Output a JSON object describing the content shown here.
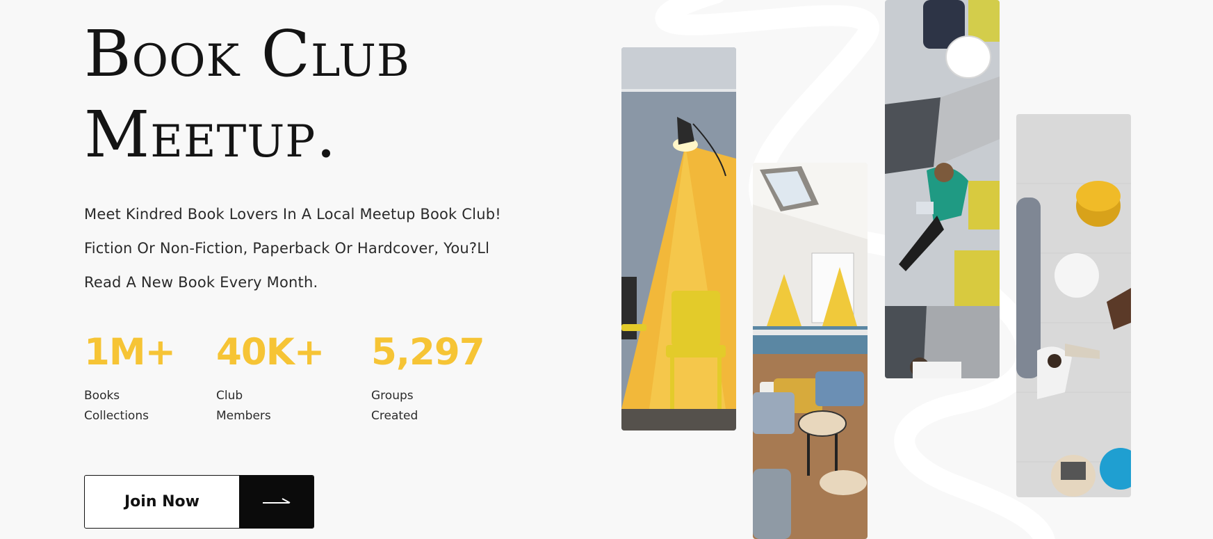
{
  "hero": {
    "title_line1": "Book Club",
    "title_line2": "Meetup.",
    "intro_lines": [
      "Meet Kindred Book Lovers In A Local Meetup Book Club!",
      "Fiction Or Non-Fiction, Paperback Or Hardcover, You?Ll",
      "Read A New Book Every Month."
    ]
  },
  "stats": [
    {
      "value": "1M+",
      "label_line1": "Books",
      "label_line2": "Collections"
    },
    {
      "value": "40K+",
      "label_line1": "Club",
      "label_line2": "Members"
    },
    {
      "value": "5,297",
      "label_line1": "Groups",
      "label_line2": "Created"
    }
  ],
  "cta": {
    "join_label": "Join Now",
    "arrow_icon": "long-arrow-right-icon"
  },
  "photos": [
    {
      "subject": "yellow wall with lamp and chair"
    },
    {
      "subject": "cafe lounge with stools and tables"
    },
    {
      "subject": "woman on sofa with laptop, top view"
    },
    {
      "subject": "people seated in lounge, top view"
    }
  ],
  "colors": {
    "accent": "#f6c435",
    "background": "#f8f8f8",
    "button_dark": "#0b0b0b",
    "text": "#222222"
  }
}
